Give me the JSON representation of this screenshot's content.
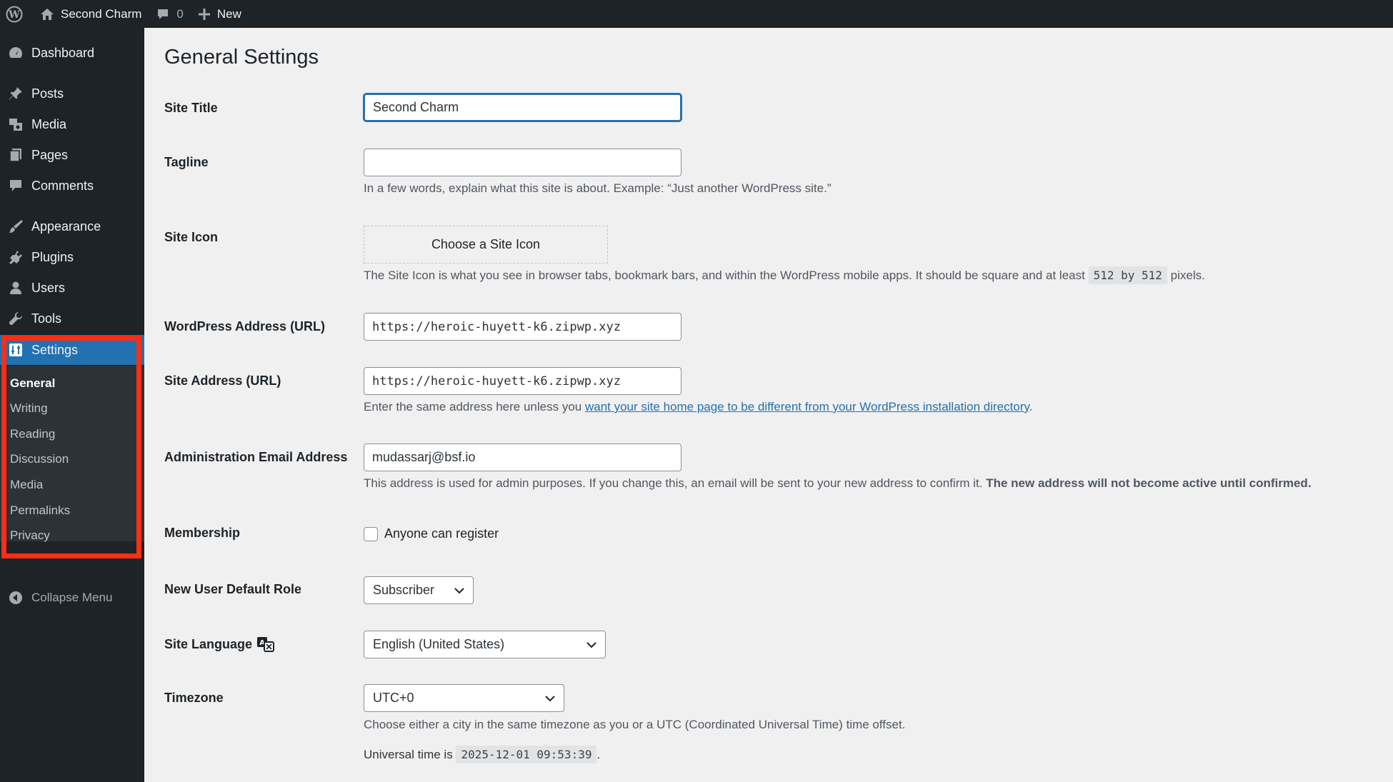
{
  "admin_bar": {
    "site_name": "Second Charm",
    "comments_count": "0",
    "new_label": "New"
  },
  "sidebar": {
    "items": [
      {
        "label": "Dashboard",
        "icon": "dashboard-icon"
      },
      {
        "label": "Posts",
        "icon": "pin-icon"
      },
      {
        "label": "Media",
        "icon": "media-icon"
      },
      {
        "label": "Pages",
        "icon": "pages-icon"
      },
      {
        "label": "Comments",
        "icon": "comment-icon"
      },
      {
        "label": "Appearance",
        "icon": "brush-icon"
      },
      {
        "label": "Plugins",
        "icon": "plugin-icon"
      },
      {
        "label": "Users",
        "icon": "user-icon"
      },
      {
        "label": "Tools",
        "icon": "wrench-icon"
      },
      {
        "label": "Settings",
        "icon": "settings-icon"
      }
    ],
    "submenu": [
      "General",
      "Writing",
      "Reading",
      "Discussion",
      "Media",
      "Permalinks",
      "Privacy"
    ],
    "collapse_label": "Collapse Menu"
  },
  "page": {
    "title": "General Settings",
    "site_title": {
      "label": "Site Title",
      "value": "Second Charm"
    },
    "tagline": {
      "label": "Tagline",
      "value": "",
      "description": "In a few words, explain what this site is about. Example: “Just another WordPress site.”"
    },
    "site_icon": {
      "label": "Site Icon",
      "button": "Choose a Site Icon",
      "description_pre": "The Site Icon is what you see in browser tabs, bookmark bars, and within the WordPress mobile apps. It should be square and at least",
      "size_code": "512 by 512",
      "description_post": "pixels."
    },
    "wp_address": {
      "label": "WordPress Address (URL)",
      "value": "https://heroic-huyett-k6.zipwp.xyz"
    },
    "site_address": {
      "label": "Site Address (URL)",
      "value": "https://heroic-huyett-k6.zipwp.xyz",
      "description_pre": "Enter the same address here unless you",
      "link": "want your site home page to be different from your WordPress installation directory",
      "description_post": "."
    },
    "admin_email": {
      "label": "Administration Email Address",
      "value": "mudassarj@bsf.io",
      "description": "This address is used for admin purposes. If you change this, an email will be sent to your new address to confirm it.",
      "description_bold": "The new address will not become active until confirmed."
    },
    "membership": {
      "label": "Membership",
      "checkbox_label": "Anyone can register"
    },
    "default_role": {
      "label": "New User Default Role",
      "value": "Subscriber"
    },
    "site_language": {
      "label": "Site Language",
      "value": "English (United States)"
    },
    "timezone": {
      "label": "Timezone",
      "value": "UTC+0",
      "description": "Choose either a city in the same timezone as you or a UTC (Coordinated Universal Time) time offset.",
      "universal_pre": "Universal time is",
      "universal_time": "2025-12-01 09:53:39",
      "universal_post": "."
    }
  },
  "colors": {
    "admin_dark": "#1d2327",
    "accent_blue": "#2271b1",
    "highlight_red": "#ff2d14"
  }
}
